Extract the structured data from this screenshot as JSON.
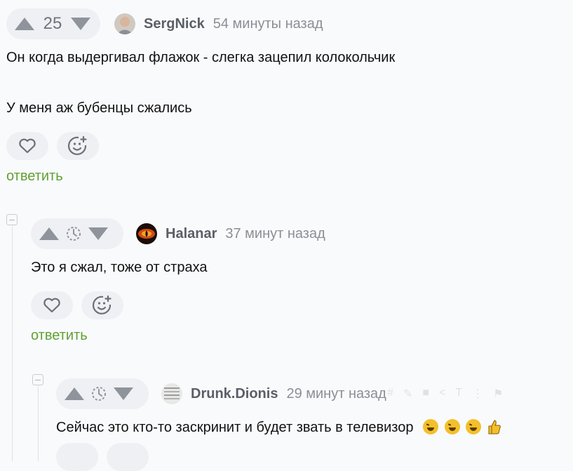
{
  "comments": [
    {
      "score": "25",
      "author": "SergNick",
      "time": "54 минуты назад",
      "paragraphs": [
        "Он когда выдергивал флажок - слегка зацепил колокольчик",
        "У меня аж бубенцы сжались"
      ],
      "reply_label": "ответить"
    },
    {
      "author": "Halanar",
      "time": "37 минут назад",
      "paragraphs": [
        "Это я сжал, тоже от страха"
      ],
      "reply_label": "ответить"
    },
    {
      "author": "Drunk.Dionis",
      "time": "29 минут назад",
      "paragraphs": [
        "Сейчас это кто-то заскринит и будет звать в телевизор"
      ],
      "emojis": [
        "rofl-emoji",
        "rofl-emoji",
        "rofl-emoji",
        "thumbs-up-emoji"
      ]
    }
  ],
  "icons": {
    "upvote": "upvote-arrow-icon",
    "downvote": "downvote-arrow-icon",
    "like": "heart-icon",
    "react": "add-reaction-icon",
    "pending": "rating-pending-icon",
    "collapse": "collapse-icon"
  },
  "colors": {
    "reply_link": "#5fa133",
    "background": "#f9fafc",
    "pill": "#eef0f4"
  }
}
